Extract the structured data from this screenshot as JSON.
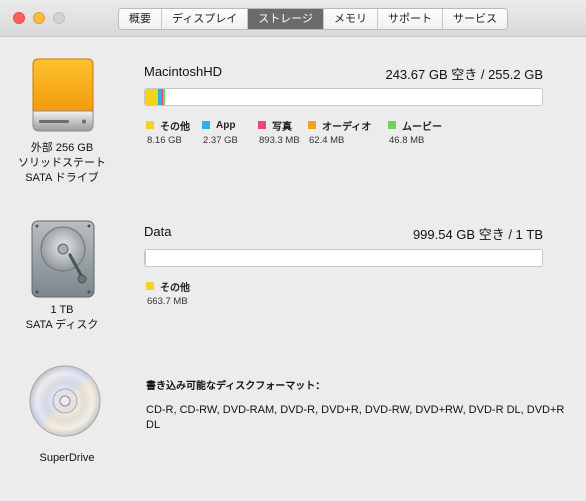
{
  "window": {
    "tabs": [
      {
        "label": "概要"
      },
      {
        "label": "ディスプレイ"
      },
      {
        "label": "ストレージ"
      },
      {
        "label": "メモリ"
      },
      {
        "label": "サポート"
      },
      {
        "label": "サービス"
      }
    ],
    "active_tab": "ストレージ"
  },
  "devices": [
    {
      "icon": "ssd-drive-icon",
      "label_lines": [
        "外部 256 GB",
        "ソリッドステート",
        "SATA ドライブ"
      ],
      "volume_name": "MacintoshHD",
      "free_text": "243.67 GB 空き / 255.2 GB",
      "used_fractions": [
        {
          "name": "その他",
          "fraction": 0.032
        },
        {
          "name": "App",
          "fraction": 0.0093
        },
        {
          "name": "写真",
          "fraction": 0.0035
        },
        {
          "name": "オーディオ",
          "fraction": 0.0024
        },
        {
          "name": "ムービー",
          "fraction": 0.0002
        }
      ],
      "legend": [
        {
          "name": "その他",
          "size": "8.16 GB",
          "color": "#f5d31b"
        },
        {
          "name": "App",
          "size": "2.37 GB",
          "color": "#29b3e6"
        },
        {
          "name": "写真",
          "size": "893.3 MB",
          "color": "#e8467c"
        },
        {
          "name": "オーディオ",
          "size": "62.4 MB",
          "color": "#f4a21c"
        },
        {
          "name": "ムービー",
          "size": "46.8 MB",
          "color": "#78d05a"
        }
      ]
    },
    {
      "icon": "hard-disk-icon",
      "label_lines": [
        "1 TB",
        "SATA ディスク"
      ],
      "volume_name": "Data",
      "free_text": "999.54 GB 空き / 1 TB",
      "used_fractions": [
        {
          "name": "その他",
          "fraction": 0.0007
        }
      ],
      "legend": [
        {
          "name": "その他",
          "size": "663.7 MB",
          "color": "#f5d31b"
        }
      ]
    },
    {
      "icon": "optical-disc-icon",
      "label_lines": [
        "SuperDrive"
      ],
      "writable_title": "書き込み可能なディスクフォーマット：",
      "writable_formats": "CD-R, CD-RW, DVD-RAM, DVD-R, DVD+R, DVD-RW, DVD+RW, DVD-R DL, DVD+R DL"
    }
  ]
}
